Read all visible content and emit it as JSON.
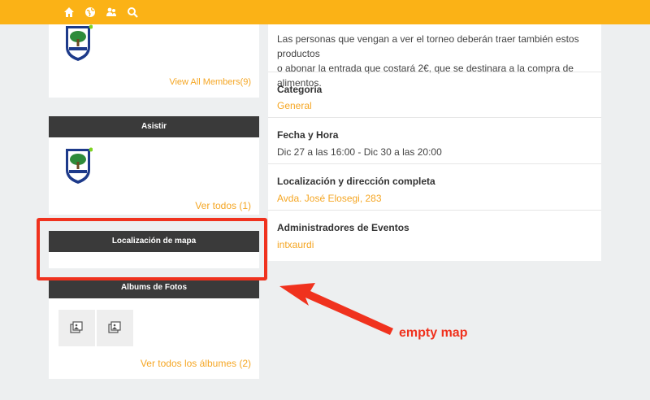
{
  "nav": {
    "icons": [
      "home-icon",
      "globe-icon",
      "people-icon",
      "search-icon"
    ]
  },
  "left": {
    "members": {
      "view_all": "View All Members(9)"
    },
    "attend": {
      "title": "Asistir",
      "see_all": "Ver todos (1)"
    },
    "map": {
      "title": "Localización de mapa"
    },
    "photos": {
      "title": "Albums de Fotos",
      "see_all": "Ver todos los álbumes (2)"
    }
  },
  "event": {
    "description_line1": "Las personas que vengan a ver el torneo deberán traer también estos productos",
    "description_line2": "o abonar la entrada que costará 2€, que se destinara a la compra de alimentos.",
    "category_label": "Categoría",
    "category_value": "General",
    "datetime_label": "Fecha y Hora",
    "datetime_value": "Dic 27 a las 16:00 - Dic 30 a las 20:00",
    "location_label": "Localización y dirección completa",
    "location_value": "Avda. José Elosegi, 283",
    "admins_label": "Administradores de Eventos",
    "admins_value": "intxaurdi"
  },
  "annotation": {
    "text": "empty map"
  },
  "colors": {
    "accent": "#fbb216",
    "link": "#f5a623",
    "header": "#3a3a3a",
    "annotation": "#f0321e"
  }
}
